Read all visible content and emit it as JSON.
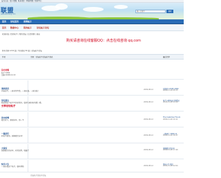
{
  "topbar": {
    "links": [
      "设为首页",
      "加入收藏",
      "联系我们",
      "网站地图",
      "帮助中心"
    ]
  },
  "header": {
    "logo_text": "联盟",
    "logo_sub": "www.lianmeng.com",
    "search_placeholder": "输入关键字",
    "search_button": "搜索"
  },
  "nav": {
    "items": [
      "首页",
      "论坛首页",
      "发表帖子"
    ]
  },
  "subnav": {
    "items": [
      "首页",
      "数据中心",
      "我的帖子",
      "论坛帖子论坛"
    ]
  },
  "banner": {
    "text": "购买请咨询在线客服QQ：点击在线咨询 qq.com"
  },
  "info": {
    "line1": "欢迎光临 | 您的帖子 | 我的论坛 | 后台管理 | 退出",
    "line2": "共有主题 1234 篇  |  今日发帖 56 篇  |  论坛帖子论坛"
  },
  "thread_header": {
    "left": "作者",
    "middle": "主题：论坛帖子论坛帖子发表",
    "right": "最后回复"
  },
  "first_post": {
    "name": "远方的客",
    "meta1": "帖子 3456",
    "meta2": "注册 2008-12-10"
  },
  "posts": [
    {
      "name": "清风明月",
      "title": "清风明月",
      "text": "内容如下，一直非常不错，一直在线，一直在线！",
      "sub": "",
      "mid": "2009-08-12",
      "right": "回复者 12345 2009",
      "right2": "2009-11-26 08:15"
    },
    {
      "name": "论坛版主",
      "title": "论坛版主",
      "text": "我觉得这个帖子写的非常好，值得大家好好的看一看。",
      "sub": "分享论坛帖子",
      "mid": "2009-08-12",
      "right": "每个人都有自己的看法",
      "right2": "2009-11-26 11:09"
    },
    {
      "name": "风中的雪",
      "title": "风中的雪",
      "text": "楼主好人，谢谢分享，顶一下",
      "sub": "",
      "mid": "2009-08-12",
      "right": "The Customer Forum",
      "right2": "2009-11-26 10:11"
    },
    {
      "name": "一路同行",
      "title": "一路同行",
      "text": "好帖子要顶，谢谢楼主分享！",
      "sub": "",
      "mid": "2009-08-12",
      "right": "一路同行 2009-11",
      "right2": "2009-11-26 16:27"
    },
    {
      "name": "大家好",
      "title": "大家好",
      "text": "感谢楼主的分享，非常实用，收藏了",
      "sub": "",
      "mid": "2009-08-12",
      "right": "谢谢楼主的分享",
      "right2": "2009-11-26 17:49"
    },
    {
      "name": "快乐人生",
      "title": "快乐人生",
      "text": "一直在看这个帖子，很有帮助",
      "sub": "",
      "mid": "2009-08-12",
      "right": "快乐人生 楼主",
      "right2": "2009-11-26 22:04"
    }
  ],
  "footer": {
    "text": "论坛帖子发表于论坛"
  }
}
